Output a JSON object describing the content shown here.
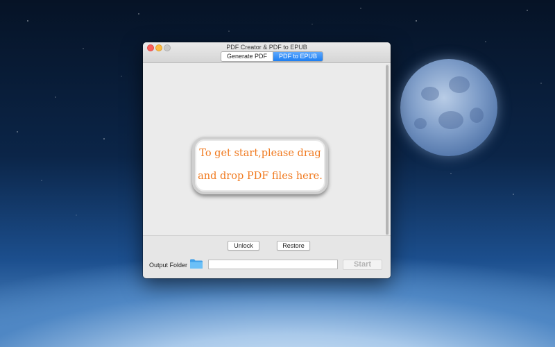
{
  "window": {
    "title": "PDF Creator & PDF to EPUB"
  },
  "tabs": [
    {
      "label": "Generate PDF",
      "selected": false
    },
    {
      "label": "PDF to EPUB",
      "selected": true
    }
  ],
  "dropzone": {
    "hint_line1": "To get start,please drag",
    "hint_line2": "and drop PDF files here."
  },
  "buttons": {
    "unlock": "Unlock",
    "restore": "Restore",
    "start": "Start"
  },
  "output": {
    "label": "Output Folder",
    "path_value": "",
    "folder_icon": "folder-icon"
  },
  "colors": {
    "accent": "#1d7ef2",
    "hint_text": "#f0791e",
    "close": "#fc605b",
    "minimize": "#fdbc40"
  }
}
